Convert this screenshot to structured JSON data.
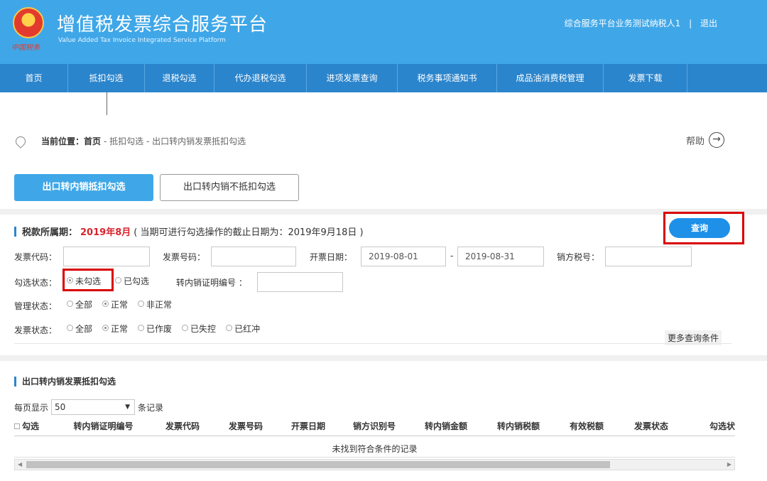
{
  "header": {
    "title": "增值税发票综合服务平台",
    "subtitle": "Value Added Tax Invoice Integrated Service Platform",
    "emblem_text": "中国税务",
    "user": "综合服务平台业务测试纳税人1",
    "separator": "|",
    "logout": "退出"
  },
  "nav": {
    "items": [
      {
        "label": "首页"
      },
      {
        "label": "抵扣勾选"
      },
      {
        "label": "退税勾选"
      },
      {
        "label": "代办退税勾选"
      },
      {
        "label": "进项发票查询"
      },
      {
        "label": "税务事项通知书"
      },
      {
        "label": "成品油消费税管理"
      },
      {
        "label": "发票下载"
      }
    ]
  },
  "breadcrumb": {
    "label": "当前位置：首页",
    "path": "- 抵扣勾选 - 出口转内销发票抵扣勾选"
  },
  "help": {
    "label": "帮助",
    "arrow": "→"
  },
  "tabs": {
    "active": "出口转内销抵扣勾选",
    "inactive": "出口转内销不抵扣勾选"
  },
  "period": {
    "label": "税款所属期：",
    "value": "2019年8月",
    "note": "( 当期可进行勾选操作的截止日期为：2019年9月18日 )"
  },
  "query_button": "查询",
  "form": {
    "invoice_code_label": "发票代码：",
    "invoice_code_value": "",
    "invoice_number_label": "发票号码：",
    "invoice_number_value": "",
    "issue_date_label": "开票日期：",
    "date_from": "2019-08-01",
    "date_sep": "-",
    "date_to": "2019-08-31",
    "seller_tax_label": "销方税号：",
    "seller_tax_value": "",
    "select_status_label": "勾选状态：",
    "select_status_options": [
      "未勾选",
      "已勾选"
    ],
    "cert_no_label": "转内销证明编号 ：",
    "cert_no_value": "",
    "mgmt_status_label": "管理状态：",
    "mgmt_status_options": [
      "全部",
      "正常",
      "非正常"
    ],
    "invoice_status_label": "发票状态：",
    "invoice_status_options": [
      "全部",
      "正常",
      "已作废",
      "已失控",
      "已红冲"
    ],
    "more_conditions": "更多查询条件"
  },
  "table_section": {
    "title": "出口转内销发票抵扣勾选",
    "page_size_label": "每页显示",
    "page_size_value": "50",
    "page_size_suffix": "条记录",
    "columns": [
      "勾选",
      "转内销证明编号",
      "发票代码",
      "发票号码",
      "开票日期",
      "销方识别号",
      "转内销金额",
      "转内销税额",
      "有效税额",
      "发票状态",
      "勾选状"
    ],
    "empty_message": "未找到符合条件的记录"
  },
  "colors": {
    "header_bg": "#3fa7e8",
    "nav_bg": "#2b85cc",
    "accent_red": "#d9232d",
    "highlight_box": "#d90000"
  }
}
